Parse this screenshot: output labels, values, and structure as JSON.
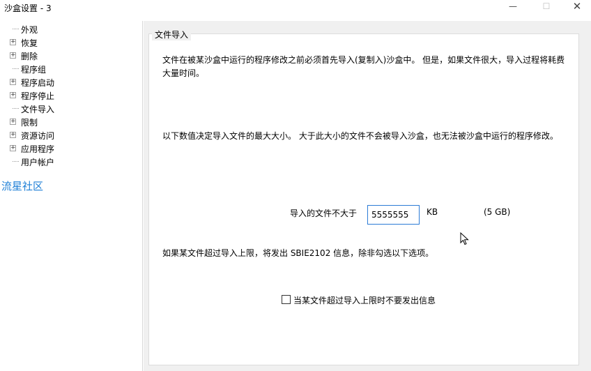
{
  "window": {
    "title": "沙盒设置 - 3",
    "min_glyph": "—",
    "max_glyph": "☐",
    "close_glyph": "✕"
  },
  "tree": {
    "items": [
      {
        "label": "外观",
        "expandable": false
      },
      {
        "label": "恢复",
        "expandable": true
      },
      {
        "label": "删除",
        "expandable": true
      },
      {
        "label": "程序组",
        "expandable": false
      },
      {
        "label": "程序启动",
        "expandable": true
      },
      {
        "label": "程序停止",
        "expandable": true
      },
      {
        "label": "文件导入",
        "expandable": false,
        "selected": true
      },
      {
        "label": "限制",
        "expandable": true
      },
      {
        "label": "资源访问",
        "expandable": true
      },
      {
        "label": "应用程序",
        "expandable": true
      },
      {
        "label": "用户帐户",
        "expandable": false
      }
    ],
    "expand_glyph": "+"
  },
  "watermark": "流星社区",
  "panel": {
    "group_title": "文件导入",
    "paragraph1": "文件在被某沙盒中运行的程序修改之前必须首先导入(复制入)沙盒中。 但是，如果文件很大，导入过程将耗费大量时间。",
    "paragraph2": "以下数值决定导入文件的最大大小。 大于此大小的文件不会被导入沙盒，也无法被沙盒中运行的程序修改。",
    "size_label": "导入的文件不大于",
    "size_value": "5555555",
    "size_unit": "KB",
    "size_human": "(5 GB)",
    "paragraph3": "如果某文件超过导入上限，将发出 SBIE2102 信息，除非勾选以下选项。",
    "checkbox_label": "当某文件超过导入上限时不要发出信息",
    "checkbox_checked": false
  }
}
